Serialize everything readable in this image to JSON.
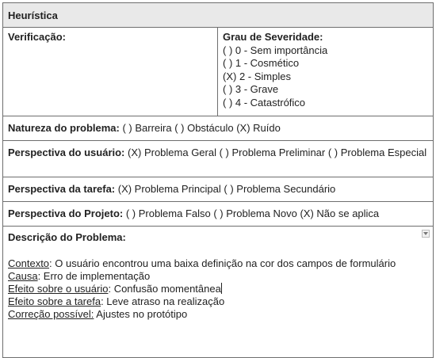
{
  "header": {
    "title": "Heurística"
  },
  "verification": {
    "label": "Verificação:",
    "severity_label": "Grau de Severidade:",
    "severity_options": [
      "( ) 0 - Sem importância",
      "( ) 1 - Cosmético",
      "(X) 2 - Simples",
      "( ) 3 - Grave",
      "( ) 4 - Catastrófico"
    ]
  },
  "natureza": {
    "label": "Natureza do problema:",
    "value": " ( ) Barreira ( ) Obstáculo (X) Ruído"
  },
  "usuario": {
    "label": "Perspectiva do usuário:",
    "value": " (X) Problema Geral ( ) Problema Preliminar ( ) Problema Especial"
  },
  "tarefa": {
    "label": "Perspectiva da tarefa:",
    "value": " (X) Problema Principal ( ) Problema Secundário"
  },
  "projeto": {
    "label": "Perspectiva do Projeto:",
    "value": " ( ) Problema Falso ( ) Problema Novo (X) Não se aplica"
  },
  "descricao": {
    "label": "Descrição do Problema:",
    "contexto_label": "Contexto",
    "contexto_value": ": O usuário encontrou uma baixa definição na cor dos campos de formulário",
    "causa_label": "Causa",
    "causa_value": ": Erro de implementação",
    "efeito_usuario_label": "Efeito sobre o usuário",
    "efeito_usuario_value": ": Confusão momentânea",
    "efeito_tarefa_label": "Efeito sobre a tarefa",
    "efeito_tarefa_value": ": Leve atraso na realização",
    "correcao_label": "Correção possível:",
    "correcao_value": " Ajustes no protótipo"
  }
}
